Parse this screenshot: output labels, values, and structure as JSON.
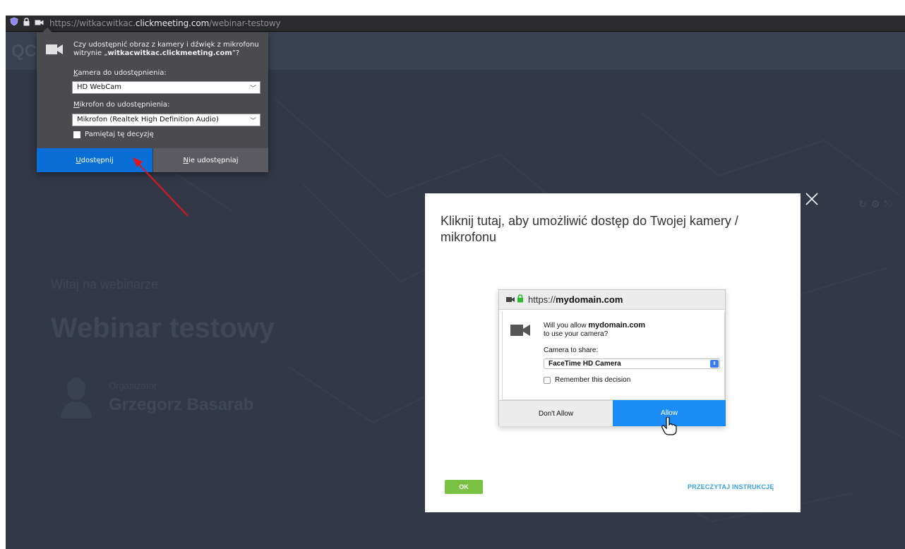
{
  "browser": {
    "url_prefix": "https://witkacwitkac.",
    "url_host": "clickmeeting.com",
    "url_path": "/webinar-testowy"
  },
  "permission_popup": {
    "message_line1": "Czy udostępnić obraz z kamery i dźwięk z mikrofonu",
    "message_line2_prefix": "witrynie „",
    "message_line2_site": "witkacwitkac.clickmeeting.com",
    "message_line2_suffix": "”?",
    "camera_label_u": "K",
    "camera_label_rest": "amera do udostępnienia:",
    "camera_value": "HD WebCam",
    "mic_label_u": "M",
    "mic_label_rest": "ikrofon do udostępnienia:",
    "mic_value": "Mikrofon (Realtek High Definition Audio)",
    "remember_label": "Pamiętaj tę decyzję",
    "share_u": "U",
    "share_rest": "dostępnij",
    "deny_u": "N",
    "deny_rest": "ie udostępniaj"
  },
  "background_page": {
    "welcome_text": "Witaj na webinarze",
    "webinar_title": "Webinar testowy",
    "organizer_label": "Organizator",
    "organizer_name": "Grzegorz Basarab"
  },
  "modal": {
    "title": "Kliknij tutaj, aby umożliwić dostęp do Twojej kamery / mikrofonu",
    "ok_label": "OK",
    "read_instructions_label": "PRZECZYTAJ INSTRUKCJĘ",
    "instruction_image": {
      "url_prefix": "https://",
      "url_host": "mydomain.com",
      "question_prefix": "Will you allow ",
      "question_host": "mydomain.com",
      "question_suffix": "to use your camera?",
      "camera_label": "Camera to share:",
      "camera_value": "FaceTime HD Camera",
      "remember_label": "Remember this decision",
      "deny_label": "Don't Allow",
      "allow_label": "Allow"
    }
  },
  "colors": {
    "page_bg": "#323845",
    "firefox_popup_bg": "#4a4a4f",
    "share_button": "#0a6ed7",
    "allow_button": "#1b8cf5",
    "ok_button": "#7ac143",
    "link": "#3aa0dc",
    "annotation_arrow": "#e0141e"
  }
}
